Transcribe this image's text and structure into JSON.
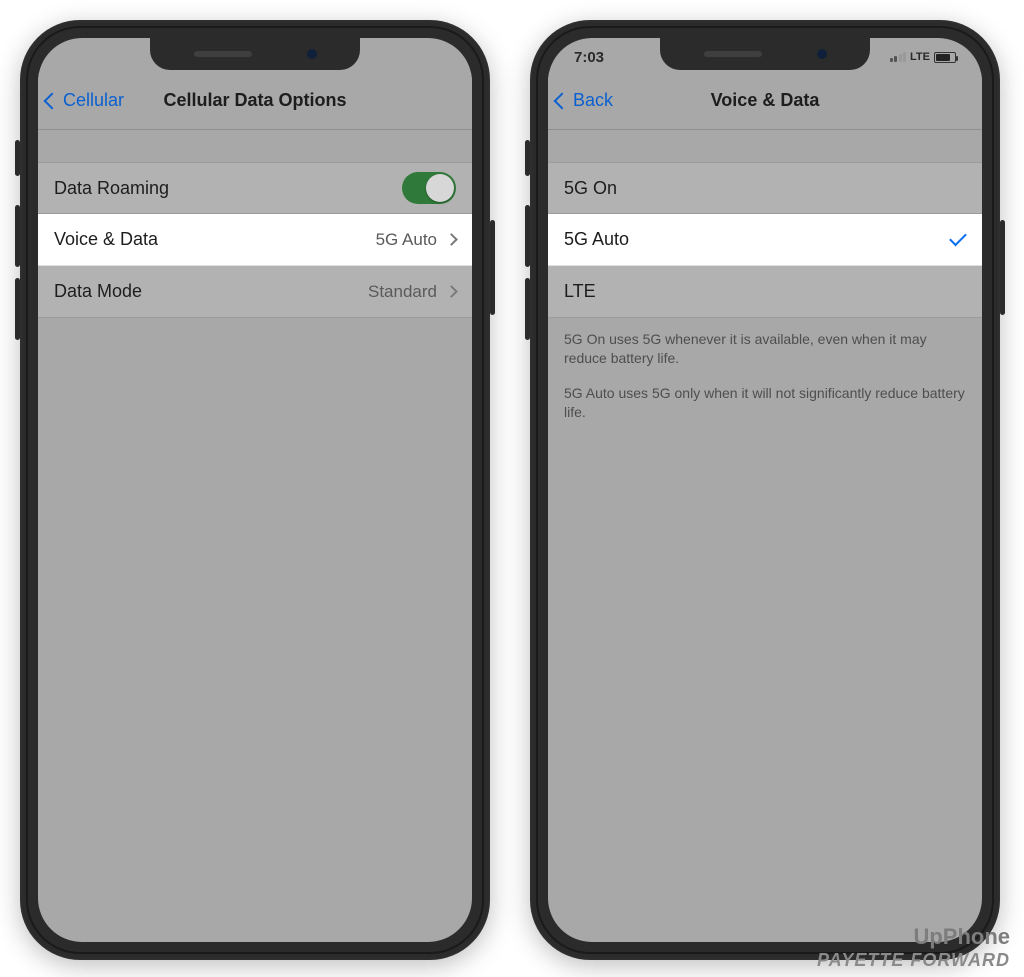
{
  "phone1": {
    "nav": {
      "back_label": "Cellular",
      "title": "Cellular Data Options"
    },
    "rows": {
      "roaming_label": "Data Roaming",
      "voice_label": "Voice & Data",
      "voice_value": "5G Auto",
      "mode_label": "Data Mode",
      "mode_value": "Standard"
    }
  },
  "phone2": {
    "status": {
      "time": "7:03",
      "carrier": "LTE"
    },
    "nav": {
      "back_label": "Back",
      "title": "Voice & Data"
    },
    "options": {
      "o1": "5G On",
      "o2": "5G Auto",
      "o3": "LTE"
    },
    "note1": "5G On uses 5G whenever it is available, even when it may reduce battery life.",
    "note2": "5G Auto uses 5G only when it will not significantly reduce battery life."
  },
  "watermark": {
    "line1": "UpPhone",
    "line2": "PAYETTE FORWARD"
  }
}
